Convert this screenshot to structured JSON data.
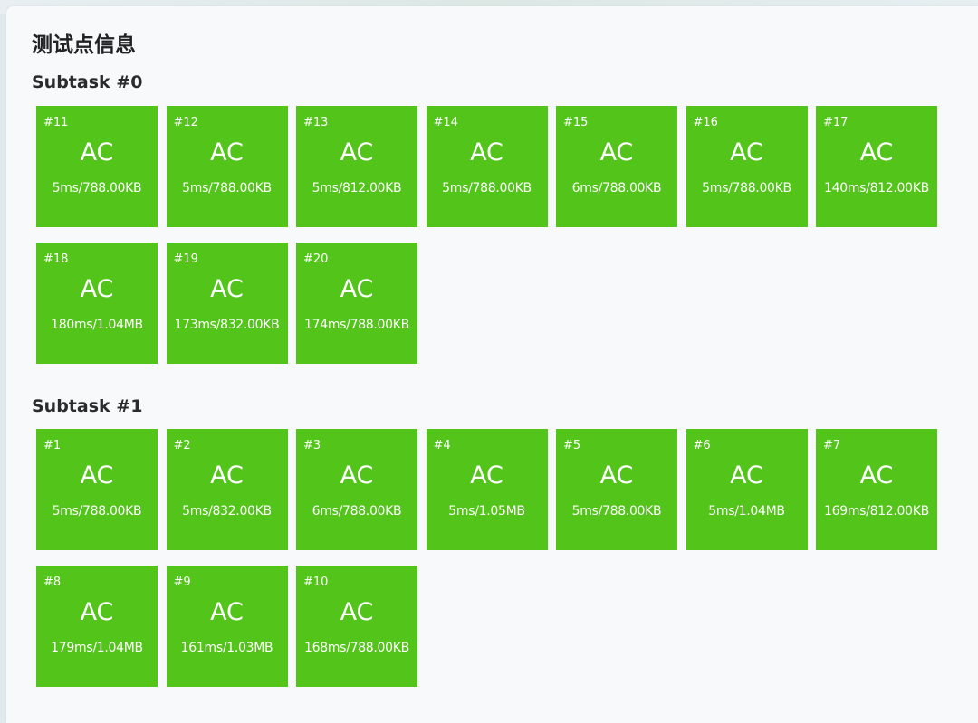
{
  "page_title": "测试点信息",
  "colors": {
    "accepted": "#52c41a",
    "text_on_status": "#ffffff"
  },
  "subtasks": [
    {
      "title": "Subtask #0",
      "cases": [
        {
          "id": "#11",
          "status": "AC",
          "info": "5ms/788.00KB"
        },
        {
          "id": "#12",
          "status": "AC",
          "info": "5ms/788.00KB"
        },
        {
          "id": "#13",
          "status": "AC",
          "info": "5ms/812.00KB"
        },
        {
          "id": "#14",
          "status": "AC",
          "info": "5ms/788.00KB"
        },
        {
          "id": "#15",
          "status": "AC",
          "info": "6ms/788.00KB"
        },
        {
          "id": "#16",
          "status": "AC",
          "info": "5ms/788.00KB"
        },
        {
          "id": "#17",
          "status": "AC",
          "info": "140ms/812.00KB"
        },
        {
          "id": "#18",
          "status": "AC",
          "info": "180ms/1.04MB"
        },
        {
          "id": "#19",
          "status": "AC",
          "info": "173ms/832.00KB"
        },
        {
          "id": "#20",
          "status": "AC",
          "info": "174ms/788.00KB"
        }
      ]
    },
    {
      "title": "Subtask #1",
      "cases": [
        {
          "id": "#1",
          "status": "AC",
          "info": "5ms/788.00KB"
        },
        {
          "id": "#2",
          "status": "AC",
          "info": "5ms/832.00KB"
        },
        {
          "id": "#3",
          "status": "AC",
          "info": "6ms/788.00KB"
        },
        {
          "id": "#4",
          "status": "AC",
          "info": "5ms/1.05MB"
        },
        {
          "id": "#5",
          "status": "AC",
          "info": "5ms/788.00KB"
        },
        {
          "id": "#6",
          "status": "AC",
          "info": "5ms/1.04MB"
        },
        {
          "id": "#7",
          "status": "AC",
          "info": "169ms/812.00KB"
        },
        {
          "id": "#8",
          "status": "AC",
          "info": "179ms/1.04MB"
        },
        {
          "id": "#9",
          "status": "AC",
          "info": "161ms/1.03MB"
        },
        {
          "id": "#10",
          "status": "AC",
          "info": "168ms/788.00KB"
        }
      ]
    }
  ]
}
